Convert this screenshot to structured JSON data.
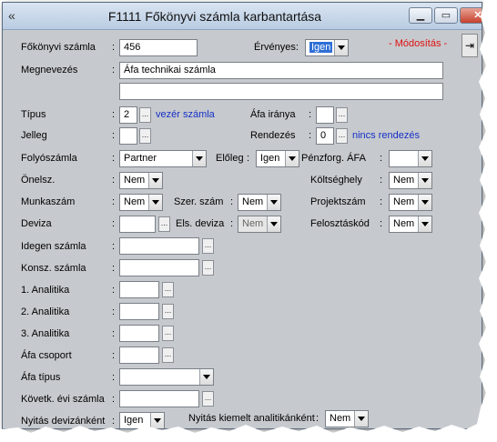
{
  "window": {
    "title": "F1111 Főkönyvi számla karbantartása",
    "app_icon": "«",
    "minimize": "▁",
    "maximize": "▭",
    "close": "✕"
  },
  "status": {
    "mode": "- Módosítás -"
  },
  "side_tool": "⇥",
  "form": {
    "fokonyvi_szamla": {
      "label": "Főkönyvi számla",
      "value": "456"
    },
    "ervenyes": {
      "label": "Érvényes:",
      "value": "Igen"
    },
    "megnevezes": {
      "label": "Megnevezés",
      "value": "Áfa technikai számla",
      "value2": ""
    },
    "tipus": {
      "label": "Típus",
      "value": "2",
      "desc": "vezér számla"
    },
    "afa_iranya": {
      "label": "Áfa iránya",
      "value": ""
    },
    "jelleg": {
      "label": "Jelleg",
      "value": ""
    },
    "rendezes": {
      "label": "Rendezés",
      "value": "0",
      "desc": "nincs rendezés"
    },
    "folyoszamla": {
      "label": "Folyószámla",
      "value": "Partner"
    },
    "eloleg": {
      "label": "Előleg",
      "value": "Igen"
    },
    "penzforg_afa": {
      "label": "Pénzforg. ÁFA",
      "value": ""
    },
    "onelsz": {
      "label": "Önelsz.",
      "value": "Nem"
    },
    "koltseghely": {
      "label": "Költséghely",
      "value": "Nem"
    },
    "munkaszam": {
      "label": "Munkaszám",
      "value": "Nem"
    },
    "szer_szam": {
      "label": "Szer. szám",
      "value": "Nem"
    },
    "projektszam": {
      "label": "Projektszám",
      "value": "Nem"
    },
    "deviza": {
      "label": "Deviza",
      "value": ""
    },
    "els_deviza": {
      "label": "Els. deviza",
      "value": "Nem"
    },
    "felosztaskod": {
      "label": "Felosztáskód",
      "value": "Nem"
    },
    "idegen_szamla": {
      "label": "Idegen számla",
      "value": ""
    },
    "konsz_szamla": {
      "label": "Konsz. számla",
      "value": ""
    },
    "analitika1": {
      "label": "1. Analitika",
      "value": ""
    },
    "analitika2": {
      "label": "2. Analitika",
      "value": ""
    },
    "analitika3": {
      "label": "3. Analitika",
      "value": ""
    },
    "afa_csoport": {
      "label": "Áfa csoport",
      "value": ""
    },
    "afa_tipus": {
      "label": "Áfa típus",
      "value": ""
    },
    "kovetk_evi_szamla": {
      "label": "Követk. évi számla",
      "value": ""
    },
    "nyitas_devizankent": {
      "label": "Nyitás devizánként",
      "value": "Igen"
    },
    "nyitas_kiemelt": {
      "label": "Nyitás kiemelt analitikánként",
      "value": "Nem"
    }
  },
  "ellipsis": "...",
  "colon": ":"
}
